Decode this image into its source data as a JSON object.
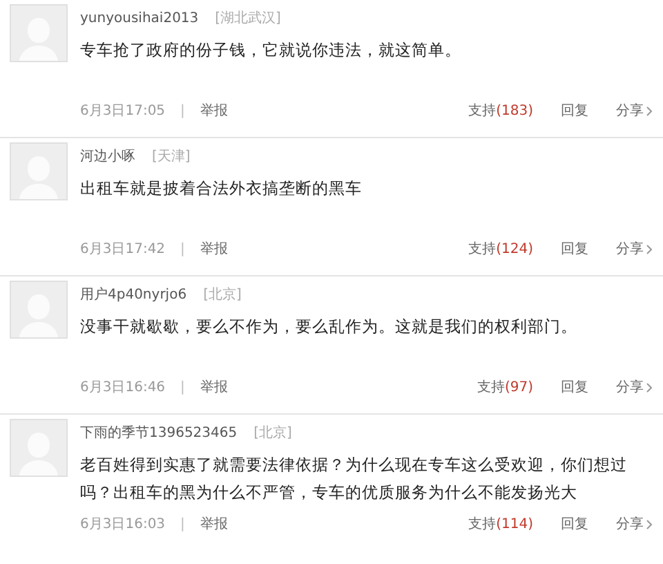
{
  "comments": [
    {
      "user": "yunyousihai2013",
      "location": "[湖北武汉]",
      "text": "专车抢了政府的份子钱，它就说你违法，就这简单。",
      "time": "6月3日17:05",
      "separator": "|",
      "report": "举报",
      "support": "支持",
      "support_count": "(183)",
      "reply": "回复",
      "share": "分享"
    },
    {
      "user": "河边小啄",
      "location": "[天津]",
      "text": "出租车就是披着合法外衣搞垄断的黑车",
      "time": "6月3日17:42",
      "separator": "|",
      "report": "举报",
      "support": "支持",
      "support_count": "(124)",
      "reply": "回复",
      "share": "分享"
    },
    {
      "user": "用户4p40nyrjo6",
      "location": "[北京]",
      "text": "没事干就歇歇，要么不作为，要么乱作为。这就是我们的权利部门。",
      "time": "6月3日16:46",
      "separator": "|",
      "report": "举报",
      "support": "支持",
      "support_count": "(97)",
      "reply": "回复",
      "share": "分享"
    },
    {
      "user": "下雨的季节1396523465",
      "location": "[北京]",
      "text": "老百姓得到实惠了就需要法律依据？为什么现在专车这么受欢迎，你们想过吗？出租车的黑为什么不严管，专车的优质服务为什么不能发扬光大",
      "time": "6月3日16:03",
      "separator": "|",
      "report": "举报",
      "support": "支持",
      "support_count": "(114)",
      "reply": "回复",
      "share": "分享"
    }
  ]
}
